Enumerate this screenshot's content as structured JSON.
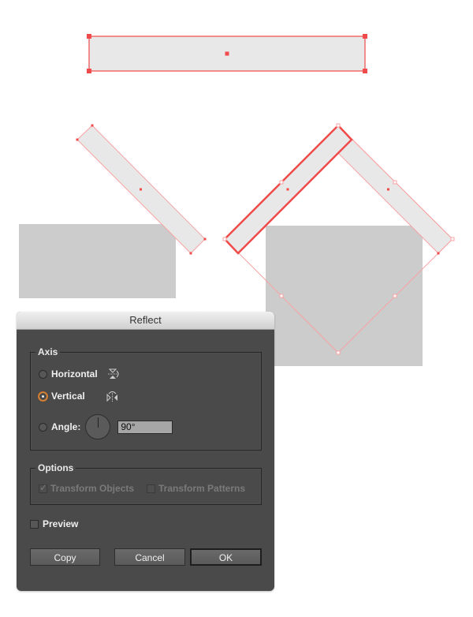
{
  "canvas": {
    "colors": {
      "selection": "#f04a4a",
      "selection_light": "#f7a3a3",
      "bar_fill": "#e8e8e8",
      "block_fill": "#cccccc"
    },
    "objects": [
      {
        "name": "top-rectangle",
        "type": "selected-rectangle"
      },
      {
        "name": "rotated-bar-left",
        "type": "selected-rotated-bar"
      },
      {
        "name": "gray-block-left",
        "type": "rectangle"
      },
      {
        "name": "gray-block-right",
        "type": "rectangle"
      },
      {
        "name": "reflected-bar-pair",
        "type": "selected-group"
      }
    ]
  },
  "dialog": {
    "title": "Reflect",
    "axis": {
      "label": "Axis",
      "options": [
        {
          "id": "horizontal",
          "label": "Horizontal",
          "icon": "reflect-horizontal-icon",
          "checked": false
        },
        {
          "id": "vertical",
          "label": "Vertical",
          "icon": "reflect-vertical-icon",
          "checked": true
        },
        {
          "id": "angle",
          "label": "Angle:",
          "checked": false
        }
      ],
      "angle_value": "90°"
    },
    "options": {
      "label": "Options",
      "transform_objects": {
        "label": "Transform Objects",
        "checked": true,
        "disabled": true
      },
      "transform_patterns": {
        "label": "Transform Patterns",
        "checked": false,
        "disabled": true
      }
    },
    "preview": {
      "label": "Preview",
      "checked": false
    },
    "buttons": {
      "copy": "Copy",
      "cancel": "Cancel",
      "ok": "OK"
    }
  }
}
